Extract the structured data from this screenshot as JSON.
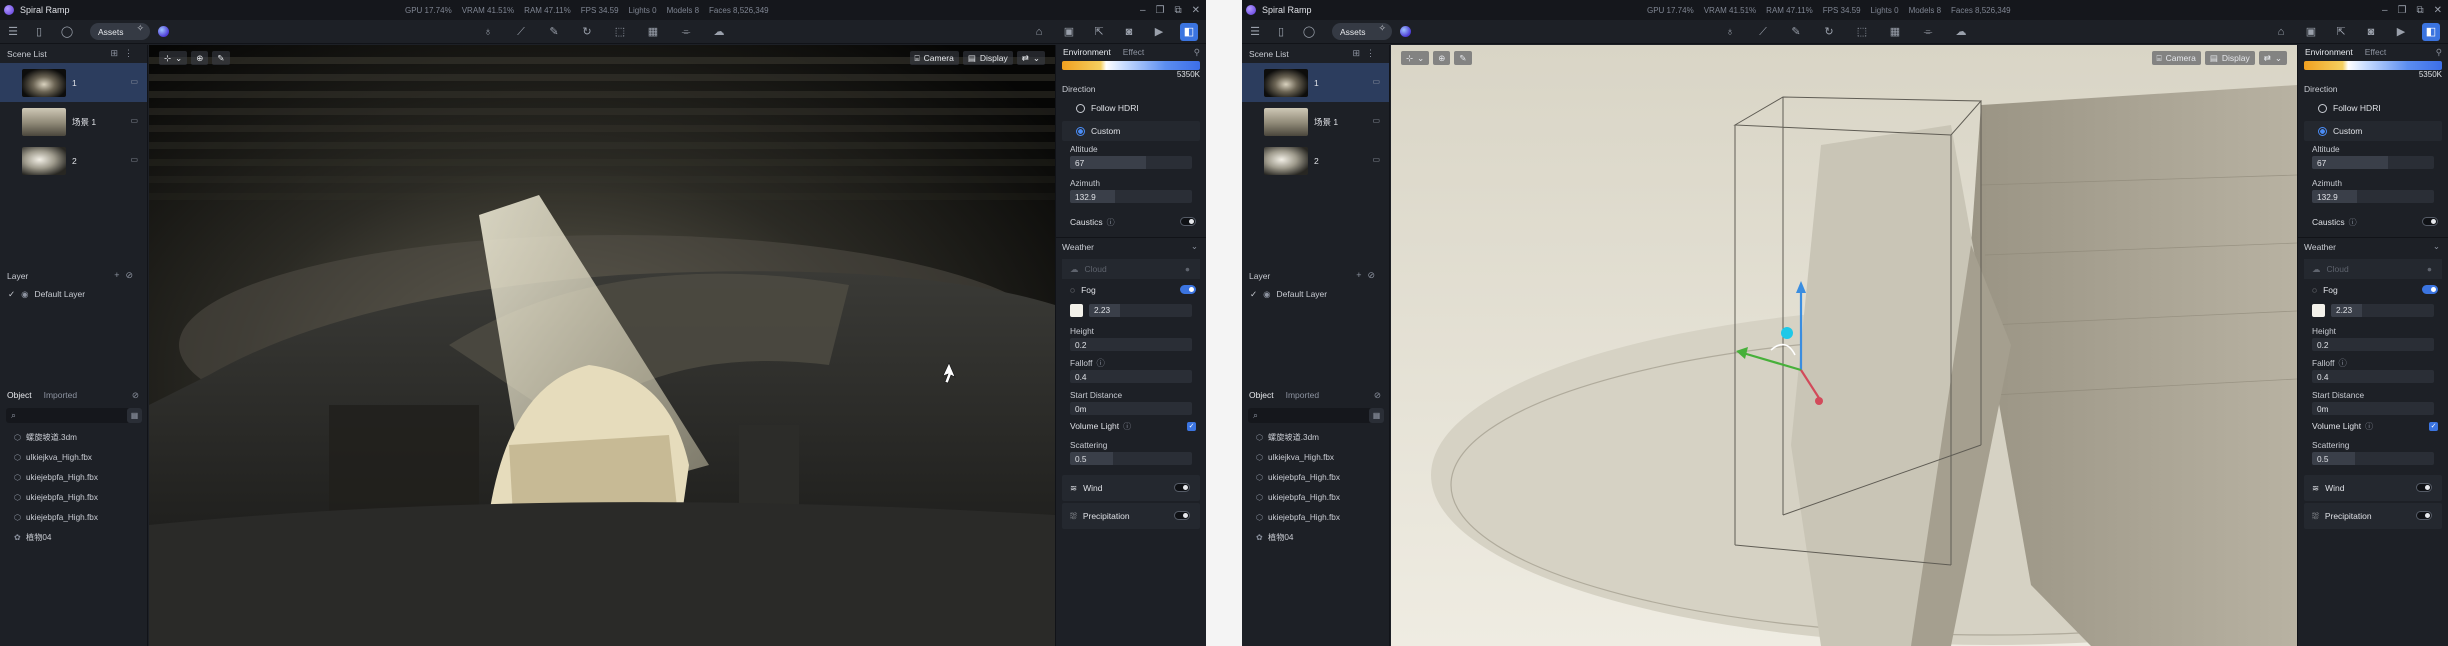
{
  "app": {
    "title": "Spiral Ramp"
  },
  "stats": {
    "gpu": "GPU 17.74%",
    "vram": "VRAM 41.51%",
    "ram": "RAM 47.11%",
    "fps": "FPS 34.59",
    "lights": "Lights 0",
    "models": "Models 8",
    "faces": "Faces 8,526,349"
  },
  "toolbar": {
    "assets_label": "Assets"
  },
  "viewport": {
    "camera_label": "Camera",
    "display_label": "Display"
  },
  "scene_list": {
    "header": "Scene List",
    "scenes": [
      {
        "name": "1",
        "selected": true
      },
      {
        "name": "场景 1",
        "selected": false
      },
      {
        "name": "2",
        "selected": false
      }
    ]
  },
  "layer": {
    "header": "Layer",
    "items": [
      {
        "name": "Default Layer"
      }
    ]
  },
  "objects": {
    "tabs": [
      {
        "label": "Object"
      },
      {
        "label": "Imported"
      }
    ],
    "items": [
      {
        "name": "螺旋坡道.3dm"
      },
      {
        "name": "ulkiejkva_High.fbx"
      },
      {
        "name": "ukiejebpfa_High.fbx"
      },
      {
        "name": "ukiejebpfa_High.fbx"
      },
      {
        "name": "ukiejebpfa_High.fbx"
      },
      {
        "name": "植物04"
      }
    ]
  },
  "environment": {
    "tabs": [
      {
        "label": "Environment"
      },
      {
        "label": "Effect"
      }
    ],
    "color_temp": "5350K",
    "direction_label": "Direction",
    "follow_hdri": "Follow HDRI",
    "custom": "Custom",
    "altitude_label": "Altitude",
    "altitude": "67",
    "altitude_fraction": 0.62,
    "azimuth_label": "Azimuth",
    "azimuth": "132.9",
    "azimuth_fraction": 0.37,
    "caustics": "Caustics",
    "caustics_on": false
  },
  "weather": {
    "header": "Weather",
    "cloud": "Cloud",
    "fog": "Fog",
    "fog_on": true,
    "fog_color": "#f3f1ea",
    "fog_density": "2.23",
    "height_label": "Height",
    "height": "0.2",
    "falloff_label": "Falloff",
    "falloff": "0.4",
    "start_distance_label": "Start Distance",
    "start_distance": "0m",
    "volume_light": "Volume Light",
    "volume_light_on": true,
    "scattering_label": "Scattering",
    "scattering": "0.5",
    "wind": "Wind",
    "wind_on": false,
    "precipitation": "Precipitation",
    "precipitation_on": false
  },
  "colors": {
    "accent": "#3b74e0",
    "selection": "#2c3d5e"
  }
}
